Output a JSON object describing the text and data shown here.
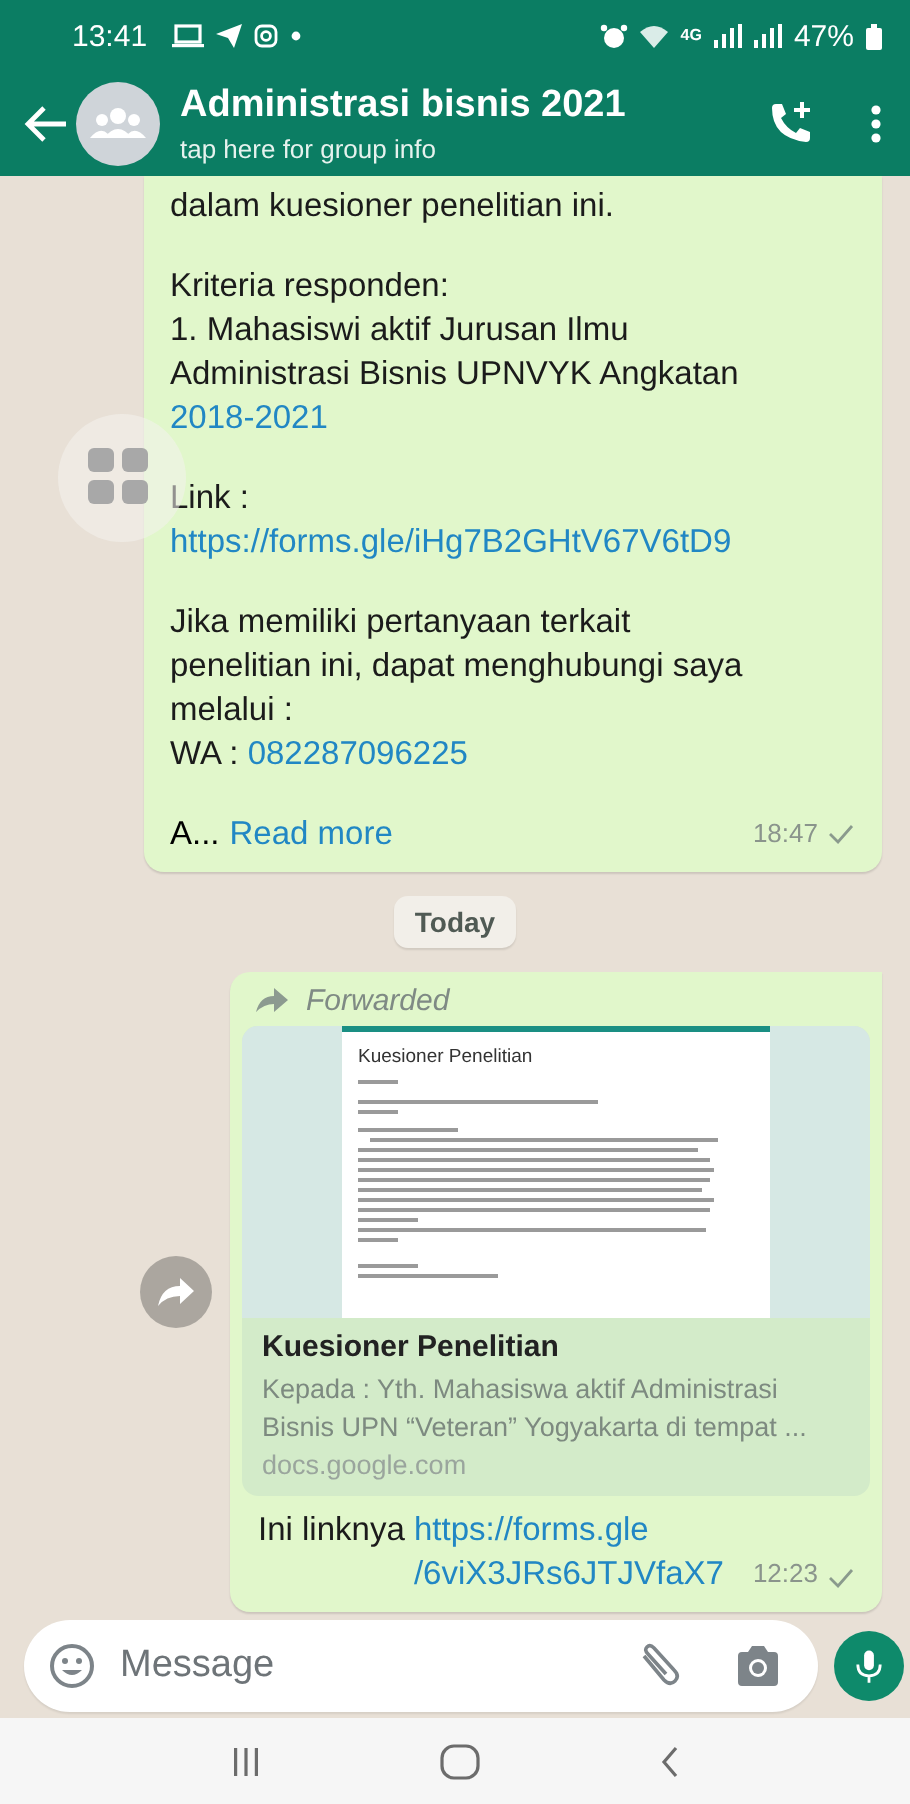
{
  "status_bar": {
    "time": "13:41",
    "network": "4G",
    "battery": "47%"
  },
  "header": {
    "title": "Administrasi bisnis 2021",
    "subtitle": "tap here for group info"
  },
  "messages": [
    {
      "kind": "text",
      "paragraphs": [
        [
          {
            "text": "dalam kuesioner penelitian ini.",
            "link": false
          }
        ],
        [
          {
            "text": "Kriteria responden:\n1. Mahasiswi aktif Jurusan Ilmu\nAdministrasi Bisnis UPNVYK Angkatan\n",
            "link": false
          },
          {
            "text": "2018-2021",
            "link": true
          }
        ],
        [
          {
            "text": "Link :\n",
            "link": false
          },
          {
            "text": "https://forms.gle/iHg7B2GHtV67V6tD9",
            "link": true
          }
        ],
        [
          {
            "text": "Jika memiliki pertanyaan terkait\npenelitian ini, dapat menghubungi saya\nmelalui :\nWA : ",
            "link": false
          },
          {
            "text": "082287096225",
            "link": true
          }
        ]
      ],
      "truncated": "A...",
      "read_more": "Read more",
      "time": "18:47",
      "read": false
    },
    {
      "kind": "date",
      "label": "Today"
    },
    {
      "kind": "link_preview",
      "forwarded": "Forwarded",
      "preview": {
        "doc_title": "Kuesioner Penelitian",
        "title": "Kuesioner Penelitian",
        "description": "Kepada : Yth. Mahasiswa aktif Administrasi Bisnis UPN “Veteran” Yogyakarta di tempat ...",
        "domain": "docs.google.com"
      },
      "paragraphs": [
        [
          {
            "text": "Ini linknya  ",
            "link": false
          },
          {
            "text": "https://forms.gle\n/6viX3JRs6JTJVfaX7",
            "link": true
          }
        ]
      ],
      "time": "12:23",
      "read": false
    }
  ],
  "composer": {
    "placeholder": "Message"
  }
}
